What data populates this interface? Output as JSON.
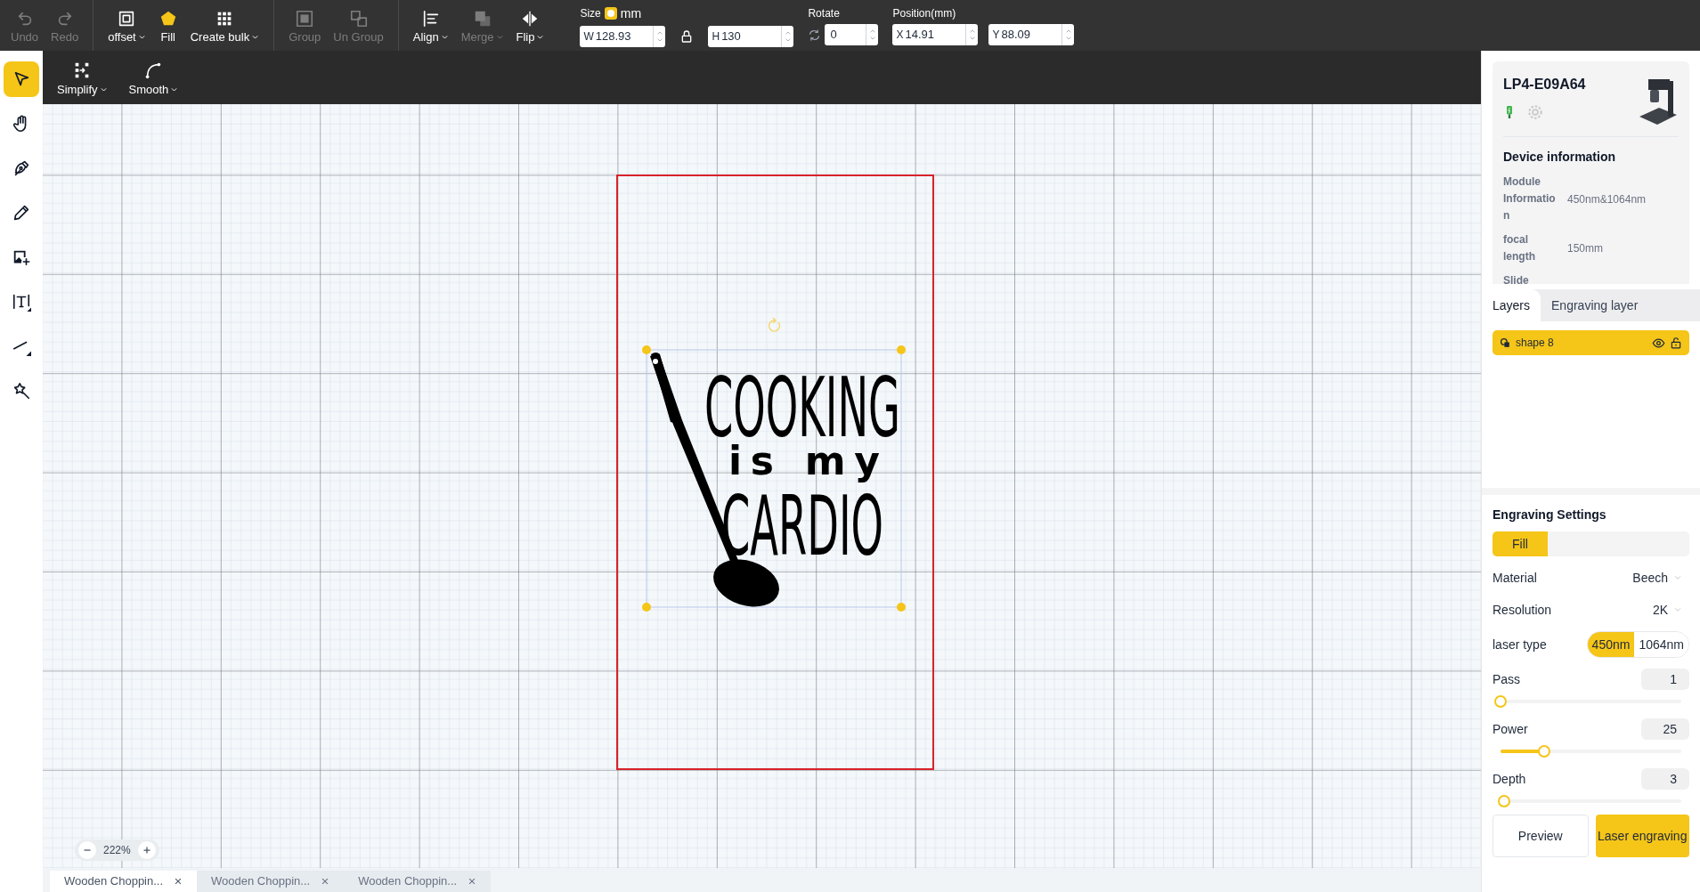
{
  "toolbar": {
    "buttons": [
      {
        "kind": "undo",
        "label": "Undo",
        "disabled": true,
        "dropdown": false
      },
      {
        "kind": "redo",
        "label": "Redo",
        "disabled": true,
        "dropdown": false
      },
      {
        "kind": "offset",
        "label": "offset",
        "disabled": false,
        "dropdown": true
      },
      {
        "kind": "fill",
        "label": "Fill",
        "disabled": false,
        "dropdown": false
      },
      {
        "kind": "bulk",
        "label": "Create bulk",
        "disabled": false,
        "dropdown": true
      },
      {
        "kind": "group",
        "label": "Group",
        "disabled": true,
        "dropdown": false
      },
      {
        "kind": "ungroup",
        "label": "Un Group",
        "disabled": true,
        "dropdown": false
      },
      {
        "kind": "align",
        "label": "Align",
        "disabled": false,
        "dropdown": true
      },
      {
        "kind": "merge",
        "label": "Merge",
        "disabled": true,
        "dropdown": true
      },
      {
        "kind": "flip",
        "label": "Flip",
        "disabled": false,
        "dropdown": true
      }
    ],
    "size": {
      "label": "Size",
      "unit": "mm",
      "unit_on": true,
      "width": {
        "prefix": "W",
        "value": "128.93"
      },
      "height": {
        "prefix": "H",
        "value": "130"
      }
    },
    "rotate": {
      "label": "Rotate",
      "value": "0"
    },
    "position": {
      "label": "Position(mm)",
      "x": {
        "prefix": "X",
        "value": "14.91"
      },
      "y": {
        "prefix": "Y",
        "value": "88.09"
      }
    }
  },
  "subtoolbar": [
    {
      "kind": "simplify",
      "label": "Simplify"
    },
    {
      "kind": "smooth",
      "label": "Smooth"
    }
  ],
  "tools": [
    {
      "kind": "select",
      "selected": true
    },
    {
      "kind": "hand",
      "selected": false
    },
    {
      "kind": "pen",
      "selected": false
    },
    {
      "kind": "pencil",
      "selected": false
    },
    {
      "kind": "image",
      "selected": false
    },
    {
      "kind": "text",
      "selected": false
    },
    {
      "kind": "line",
      "selected": false
    },
    {
      "kind": "magic",
      "selected": false
    }
  ],
  "canvas": {
    "design": {
      "lines": [
        "COOKING",
        "is my",
        "CARDIO"
      ]
    },
    "zoom": "222%"
  },
  "file_tabs": [
    {
      "label": "Wooden Choppin...",
      "selected": true
    },
    {
      "label": "Wooden Choppin...",
      "selected": false
    },
    {
      "label": "Wooden Choppin...",
      "selected": false
    }
  ],
  "device": {
    "name": "LP4-E09A64",
    "heading": "Device information",
    "info": [
      {
        "label": "Module Informatio n",
        "value": "450nm&1064nm"
      },
      {
        "label": "focal length",
        "value": "150mm"
      },
      {
        "label": "Slide"
      }
    ]
  },
  "panel_tabs": [
    {
      "label": "Layers",
      "selected": true
    },
    {
      "label": "Engraving layer",
      "selected": false
    }
  ],
  "layers": [
    {
      "name": "shape 8",
      "selected": true
    }
  ],
  "engraving": {
    "title": "Engraving Settings",
    "modes": [
      {
        "label": "Fill",
        "selected": true
      }
    ],
    "selects": [
      {
        "label": "Material",
        "value": "Beech"
      },
      {
        "label": "Resolution",
        "value": "2K"
      }
    ],
    "laser_type": {
      "label": "laser type",
      "options": [
        {
          "label": "450nm",
          "selected": true
        },
        {
          "label": "1064nm",
          "selected": false
        }
      ]
    },
    "sliders": [
      {
        "label": "Pass",
        "value": "1",
        "level": 0
      },
      {
        "label": "Power",
        "value": "25",
        "level": 0.24
      },
      {
        "label": "Depth",
        "value": "3",
        "level": 0.02
      }
    ],
    "buttons": [
      {
        "kind": "secondary",
        "label": "Preview"
      },
      {
        "kind": "primary",
        "label": "Laser engraving"
      }
    ]
  }
}
